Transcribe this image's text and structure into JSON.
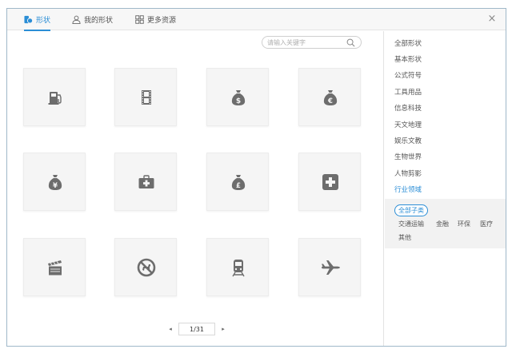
{
  "tabs": [
    {
      "label": "形状",
      "active": true
    },
    {
      "label": "我的形状",
      "active": false
    },
    {
      "label": "更多资源",
      "active": false
    }
  ],
  "close_label": "×",
  "search": {
    "placeholder": "请输入关键字"
  },
  "shapes": [
    {
      "icon": "fuel-pump-icon"
    },
    {
      "icon": "film-strip-icon"
    },
    {
      "icon": "dollar-bag-icon"
    },
    {
      "icon": "euro-bag-icon"
    },
    {
      "icon": "yen-bag-icon"
    },
    {
      "icon": "first-aid-kit-icon"
    },
    {
      "icon": "pound-bag-icon"
    },
    {
      "icon": "medical-cross-icon"
    },
    {
      "icon": "clapperboard-icon"
    },
    {
      "icon": "no-dogs-icon"
    },
    {
      "icon": "train-icon"
    },
    {
      "icon": "airplane-icon"
    }
  ],
  "pager": {
    "prev": "◂",
    "page": "1/31",
    "next": "▸"
  },
  "categories": [
    {
      "label": "全部形状",
      "active": false
    },
    {
      "label": "基本形状",
      "active": false
    },
    {
      "label": "公式符号",
      "active": false
    },
    {
      "label": "工具用品",
      "active": false
    },
    {
      "label": "信息科技",
      "active": false
    },
    {
      "label": "天文地理",
      "active": false
    },
    {
      "label": "娱乐文教",
      "active": false
    },
    {
      "label": "生物世界",
      "active": false
    },
    {
      "label": "人物剪影",
      "active": false
    },
    {
      "label": "行业领域",
      "active": true
    }
  ],
  "subcategories": [
    {
      "label": "全部子类",
      "active": true
    },
    {
      "label": "交通运输",
      "active": false
    },
    {
      "label": "金融",
      "active": false
    },
    {
      "label": "环保",
      "active": false
    },
    {
      "label": "医疗",
      "active": false
    },
    {
      "label": "其他",
      "active": false
    }
  ],
  "colors": {
    "accent": "#2b8ed6",
    "icon": "#6d6d6d"
  }
}
